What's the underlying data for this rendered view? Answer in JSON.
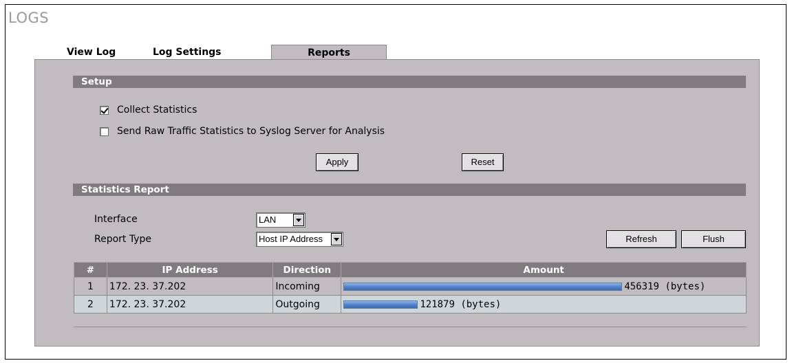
{
  "page": {
    "title": "LOGS"
  },
  "tabs": [
    {
      "label": "View Log"
    },
    {
      "label": "Log Settings"
    },
    {
      "label": "Reports"
    }
  ],
  "setup": {
    "heading": "Setup",
    "collect_statistics": {
      "label": "Collect Statistics",
      "checked": true
    },
    "send_raw": {
      "label": "Send Raw Traffic Statistics to Syslog Server for Analysis",
      "checked": false
    },
    "apply_label": "Apply",
    "reset_label": "Reset"
  },
  "statistics": {
    "heading": "Statistics Report",
    "interface_label": "Interface",
    "interface_value": "LAN",
    "report_type_label": "Report Type",
    "report_type_value": "Host IP Address",
    "refresh_label": "Refresh",
    "flush_label": "Flush",
    "columns": [
      "#",
      "IP Address",
      "Direction",
      "Amount"
    ],
    "rows": [
      {
        "index": "1",
        "ip": "172. 23. 37.202",
        "direction": "Incoming",
        "amount": "456319 (bytes)",
        "bar_fraction": 1.0
      },
      {
        "index": "2",
        "ip": "172. 23. 37.202",
        "direction": "Outgoing",
        "amount": "121879 (bytes)",
        "bar_fraction": 0.267
      }
    ]
  },
  "colors": {
    "section_bar": "#7f7b7f",
    "panel": "#c0bcc0",
    "bar": "#4f7fc7",
    "row_alt": "#cfd6da"
  }
}
